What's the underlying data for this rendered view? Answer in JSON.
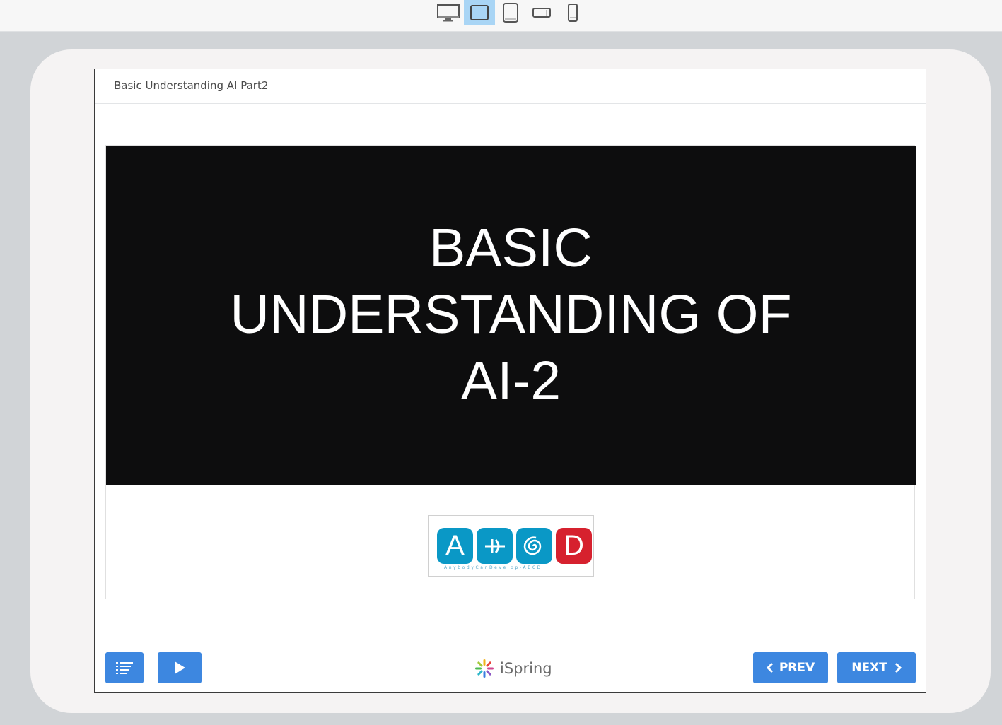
{
  "device_toolbar": {
    "buttons": [
      {
        "name": "desktop",
        "icon": "desktop-icon",
        "active": false
      },
      {
        "name": "tablet-landscape",
        "icon": "tablet-landscape-icon",
        "active": true
      },
      {
        "name": "tablet-portrait",
        "icon": "tablet-portrait-icon",
        "active": false
      },
      {
        "name": "phone-landscape",
        "icon": "phone-landscape-icon",
        "active": false
      },
      {
        "name": "phone-portrait",
        "icon": "phone-portrait-icon",
        "active": false
      }
    ]
  },
  "player": {
    "title": "Basic Understanding AI Part2"
  },
  "slide": {
    "title": "BASIC\nUNDERSTANDING OF\nAI-2",
    "logo": {
      "letters": [
        "A",
        "",
        "",
        "D"
      ],
      "tagline": "AnybodyCanDevelop-ABCD",
      "colors": [
        "#0a98c6",
        "#0a98c6",
        "#0a98c6",
        "#d6212e"
      ]
    }
  },
  "footer": {
    "outline_icon": "outline-list-icon",
    "play_icon": "play-icon",
    "brand_name": "iSpring",
    "prev_label": "PREV",
    "next_label": "NEXT"
  },
  "colors": {
    "accent": "#3d87e0",
    "active_device": "#a9d5f5"
  }
}
